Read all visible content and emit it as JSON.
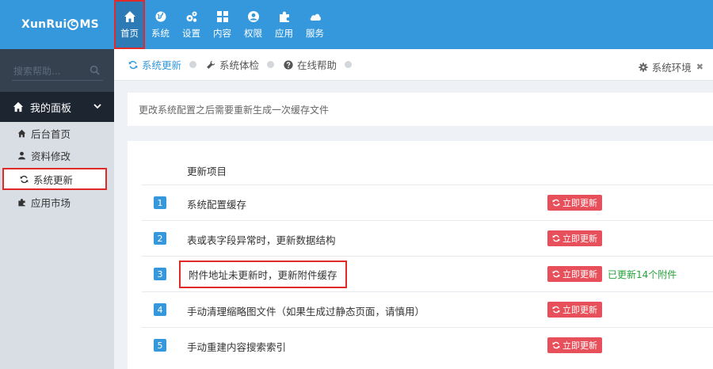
{
  "logo": {
    "pre": "XunRui",
    "badge": "C",
    "post": "MS"
  },
  "nav": [
    {
      "label": "首页",
      "icon": "home-icon"
    },
    {
      "label": "系统",
      "icon": "globe-icon"
    },
    {
      "label": "设置",
      "icon": "cogs-icon"
    },
    {
      "label": "内容",
      "icon": "grid-icon"
    },
    {
      "label": "权限",
      "icon": "user-icon"
    },
    {
      "label": "应用",
      "icon": "puzzle-icon"
    },
    {
      "label": "服务",
      "icon": "cloud-icon"
    }
  ],
  "sidebar": {
    "search_placeholder": "搜索帮助...",
    "panel_title": "我的面板",
    "items": [
      {
        "label": "后台首页",
        "icon": "home-icon"
      },
      {
        "label": "资料修改",
        "icon": "user-icon"
      },
      {
        "label": "系统更新",
        "icon": "refresh-icon"
      },
      {
        "label": "应用市场",
        "icon": "puzzle-icon"
      }
    ]
  },
  "tabs": [
    {
      "label": "系统更新",
      "icon": "refresh-icon"
    },
    {
      "label": "系统体检",
      "icon": "wrench-icon"
    },
    {
      "label": "在线帮助",
      "icon": "question-icon"
    }
  ],
  "env": {
    "label": "系统环境",
    "close": "✖"
  },
  "notice": "更改系统配置之后需要重新生成一次缓存文件",
  "table": {
    "header": "更新项目",
    "button_label": "立即更新",
    "rows": [
      {
        "num": "1",
        "label": "系统配置缓存",
        "status": ""
      },
      {
        "num": "2",
        "label": "表或表字段异常时，更新数据结构",
        "status": ""
      },
      {
        "num": "3",
        "label": "附件地址未更新时，更新附件缓存",
        "status": "已更新14个附件"
      },
      {
        "num": "4",
        "label": "手动清理缩略图文件（如果生成过静态页面，请慎用）",
        "status": ""
      },
      {
        "num": "5",
        "label": "手动重建内容搜索索引",
        "status": ""
      }
    ]
  },
  "colors": {
    "header": "#3598dc",
    "sidebar": "#364150",
    "accent_red": "#e7505a",
    "success": "#26a13b"
  }
}
